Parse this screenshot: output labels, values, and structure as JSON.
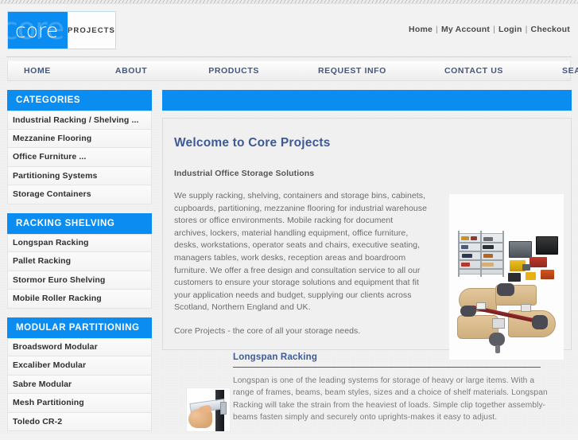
{
  "brand": {
    "logo_word": "core",
    "logo_ghost": "core",
    "logo_sub": "PROJECTS",
    "accent_color": "#0a8cf0",
    "heading_color": "#3d5a96"
  },
  "header": {
    "top_links": [
      {
        "label": "Home"
      },
      {
        "label": "My Account"
      },
      {
        "label": "Login"
      },
      {
        "label": "Checkout"
      }
    ],
    "separator": "|"
  },
  "nav": {
    "items": [
      {
        "label": "HOME"
      },
      {
        "label": "ABOUT"
      },
      {
        "label": "PRODUCTS"
      },
      {
        "label": "REQUEST INFO"
      },
      {
        "label": "CONTACT US"
      },
      {
        "label": "SEARCH"
      }
    ]
  },
  "sidebar": {
    "panels": [
      {
        "title": "CATEGORIES",
        "items": [
          {
            "label": "Industrial Racking / Shelving ..."
          },
          {
            "label": "Mezzanine Flooring"
          },
          {
            "label": "Office Furniture ..."
          },
          {
            "label": "Partitioning Systems"
          },
          {
            "label": "Storage Containers"
          }
        ]
      },
      {
        "title": "RACKING SHELVING",
        "items": [
          {
            "label": "Longspan Racking"
          },
          {
            "label": "Pallet Racking"
          },
          {
            "label": "Stormor Euro Shelving"
          },
          {
            "label": "Mobile Roller Racking"
          }
        ]
      },
      {
        "title": "MODULAR PARTITIONING",
        "items": [
          {
            "label": "Broadsword Modular"
          },
          {
            "label": "Excaliber Modular"
          },
          {
            "label": "Sabre Modular"
          },
          {
            "label": "Mesh Partitioning"
          },
          {
            "label": "Toledo CR-2"
          }
        ]
      }
    ]
  },
  "main": {
    "welcome": {
      "title": "Welcome to Core Projects",
      "subtitle": "Industrial Office Storage Solutions",
      "paragraph1": "We supply racking, shelving, containers and storage bins, cabinets, cupboards, partitioning, mezzanine flooring for industrial warehouse stores or office environments. Mobile racking for document archives, lockers, material handling equipment, office furniture, desks, workstations, operator seats and chairs, executive seating, managers tables, work desks, reception areas and boardroom furniture. We offer a free design and consultation service to all our customers to ensure your storage solutions and equipment that fit your application needs and budget, supplying our clients across Scotland, Northern England and UK.",
      "paragraph2": "Core Projects - the core of all your storage needs.",
      "collage_alt": "storage-products-collage"
    },
    "longspan": {
      "title": "Longspan Racking",
      "body": "Longspan is one of the leading systems for storage of heavy or large items. With a range of frames, beams, beam styles, sizes and a choice of shelf materials. Longspan Racking will take the strain from the heaviest of loads. Simple clip together assembly-beams fasten simply and securely onto uprights-makes it easy to adjust.",
      "thumb_alt": "longspan-beam-clip-photo"
    }
  }
}
